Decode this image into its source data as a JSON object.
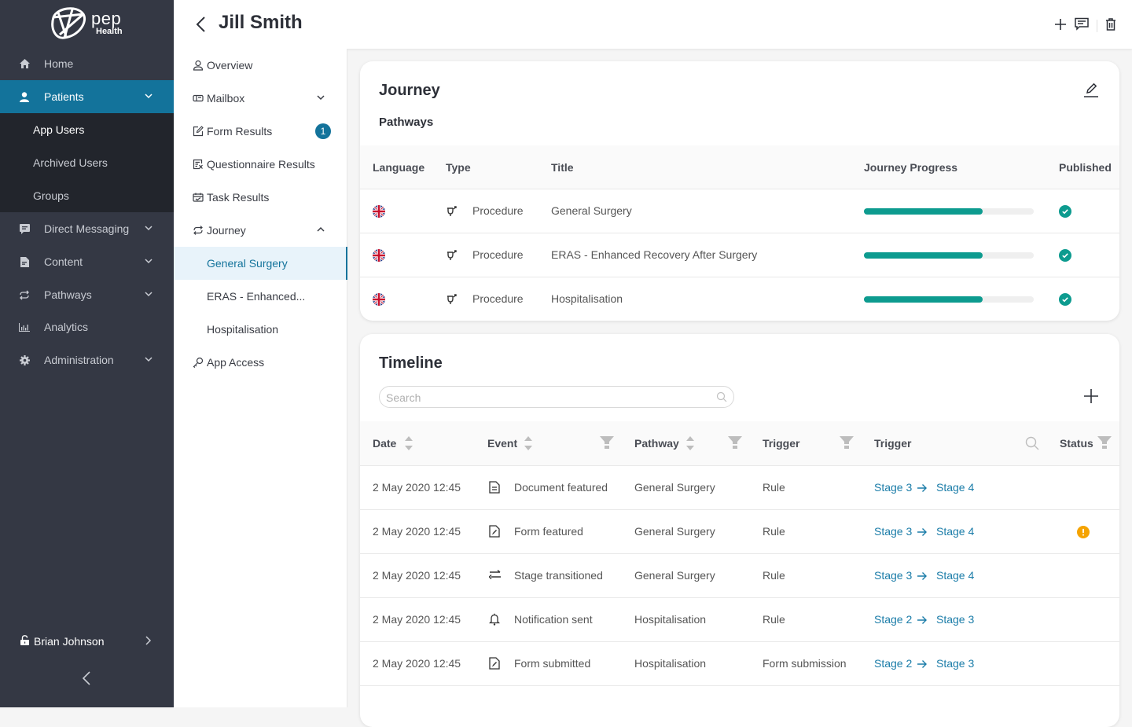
{
  "brand": {
    "name": "pep",
    "sub": "Health"
  },
  "sidebar": {
    "items": [
      {
        "label": "Home",
        "icon": "home-icon"
      },
      {
        "label": "Patients",
        "icon": "user-icon",
        "active": true
      },
      {
        "label": "Direct Messaging",
        "icon": "message-icon"
      },
      {
        "label": "Content",
        "icon": "document-icon"
      },
      {
        "label": "Pathways",
        "icon": "repeat-icon"
      },
      {
        "label": "Analytics",
        "icon": "bar-chart-icon"
      },
      {
        "label": "Administration",
        "icon": "gear-icon"
      }
    ],
    "patients_sub": [
      "App Users",
      "Archived Users",
      "Groups"
    ],
    "user": "Brian Johnson"
  },
  "header": {
    "title": "Jill Smith"
  },
  "subnav": {
    "items": [
      {
        "label": "Overview"
      },
      {
        "label": "Mailbox"
      },
      {
        "label": "Form Results",
        "badge": "1"
      },
      {
        "label": "Questionnaire Results"
      },
      {
        "label": "Task Results"
      },
      {
        "label": "Journey"
      },
      {
        "label": "General Surgery"
      },
      {
        "label": "ERAS - Enhanced..."
      },
      {
        "label": "Hospitalisation"
      },
      {
        "label": "App Access"
      }
    ]
  },
  "journey": {
    "title": "Journey",
    "subtitle": "Pathways",
    "columns": [
      "Language",
      "Type",
      "Title",
      "Journey Progress",
      "Published"
    ],
    "rows": [
      {
        "type": "Procedure",
        "title": "General Surgery",
        "progress": 0.7,
        "published": true
      },
      {
        "type": "Procedure",
        "title": "ERAS - Enhanced Recovery After Surgery",
        "progress": 0.7,
        "published": true
      },
      {
        "type": "Procedure",
        "title": "Hospitalisation",
        "progress": 0.7,
        "published": true
      }
    ]
  },
  "timeline": {
    "title": "Timeline",
    "search_placeholder": "Search",
    "columns": [
      "Date",
      "Event",
      "Pathway",
      "Trigger",
      "Trigger",
      "Status"
    ],
    "rows": [
      {
        "date": "2 May 2020 12:45",
        "event": "Document featured",
        "icon": "document-icon",
        "pathway": "General Surgery",
        "trigger": "Rule",
        "from": "Stage 3",
        "to": "Stage 4",
        "status": ""
      },
      {
        "date": "2 May 2020 12:45",
        "event": "Form featured",
        "icon": "form-icon",
        "pathway": "General Surgery",
        "trigger": "Rule",
        "from": "Stage 3",
        "to": "Stage 4",
        "status": "warning"
      },
      {
        "date": "2 May 2020 12:45",
        "event": "Stage transitioned",
        "icon": "transition-icon",
        "pathway": "General Surgery",
        "trigger": "Rule",
        "from": "Stage 3",
        "to": "Stage 4",
        "status": ""
      },
      {
        "date": "2 May 2020 12:45",
        "event": "Notification sent",
        "icon": "bell-icon",
        "pathway": "Hospitalisation",
        "trigger": "Rule",
        "from": "Stage 2",
        "to": "Stage 3",
        "status": ""
      },
      {
        "date": "2 May 2020 12:45",
        "event": "Form submitted",
        "icon": "form-icon",
        "pathway": "Hospitalisation",
        "trigger": "Form submission",
        "from": "Stage 2",
        "to": "Stage 3",
        "status": ""
      }
    ]
  },
  "colors": {
    "accent": "#13739b",
    "progress": "#0d9b8f",
    "warning": "#f5a300",
    "sidebar": "#343844"
  }
}
